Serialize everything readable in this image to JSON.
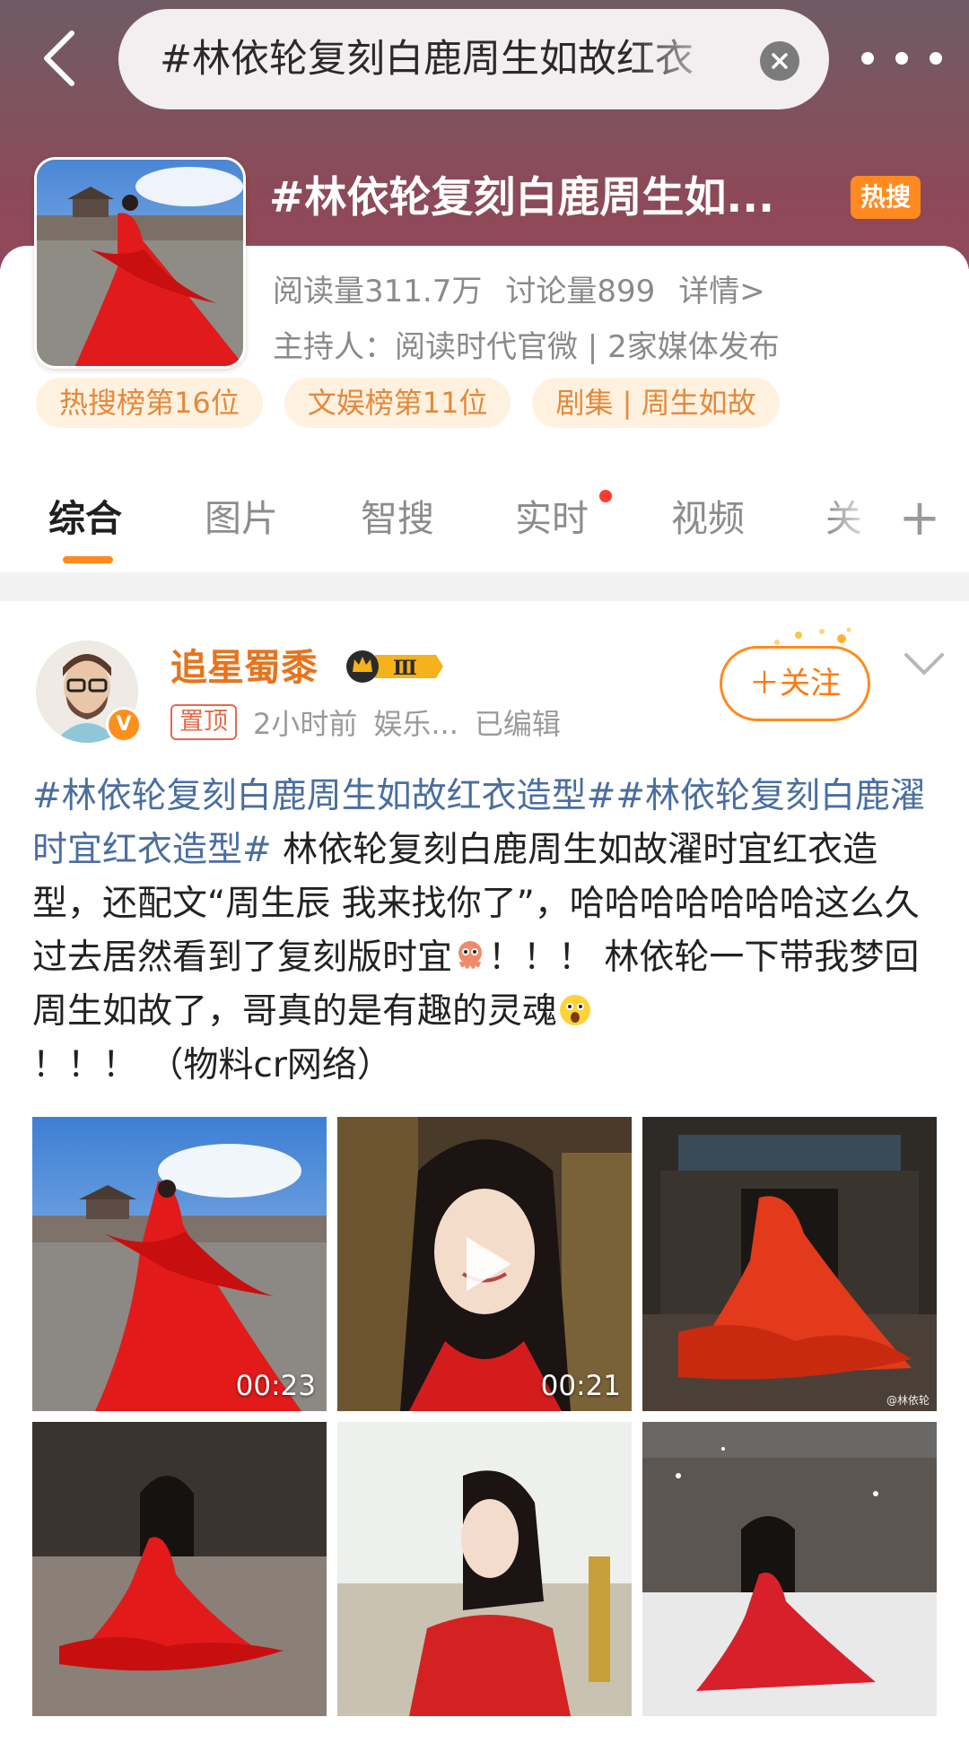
{
  "header": {
    "search_query": "#林依轮复刻白鹿周生如故红衣",
    "back_icon": "back-arrow-icon",
    "clear_icon": "clear-circle-icon",
    "more_icon": "more-dots-icon"
  },
  "topic": {
    "title": "#林依轮复刻白鹿周生如...",
    "hot_badge": "热搜",
    "reads": "阅读量311.7万",
    "discussions": "讨论量899",
    "details": "详情>",
    "host": "主持人：阅读时代官微 | 2家媒体发布",
    "tags": [
      "热搜榜第16位",
      "文娱榜第11位",
      "剧集 | 周生如故"
    ]
  },
  "tabs": [
    "综合",
    "图片",
    "智搜",
    "实时",
    "视频",
    "关"
  ],
  "post": {
    "user_name": "追星蜀黍",
    "rank_badge": "Ⅲ",
    "pin_label": "置顶",
    "time": "2小时前",
    "source": "娱乐...",
    "edited": "已编辑",
    "follow_label": "＋关注",
    "hashtag1": "#林依轮复刻白鹿周生如故红衣造型#",
    "hashtag2": "#林依轮复刻白鹿濯时宜红衣造型#",
    "text1": " 林依轮复刻白鹿周生如故濯时宜红衣造型，还配文“周生辰 我来找你了”，哈哈哈哈哈哈哈这么久过去居然看到了复刻版时宜",
    "text2": "！！！ 林依轮一下带我梦回周生如故了，哥真的是有趣的灵魂",
    "text3": "！！！ （物料cr网络）",
    "images": [
      {
        "duration": "00:23"
      },
      {
        "duration": "00:21"
      },
      {
        "watermark": "@林依轮"
      }
    ]
  },
  "colors": {
    "accent": "#ff8a1f",
    "hashtag": "#4a6ea0",
    "username": "#e7741c"
  }
}
